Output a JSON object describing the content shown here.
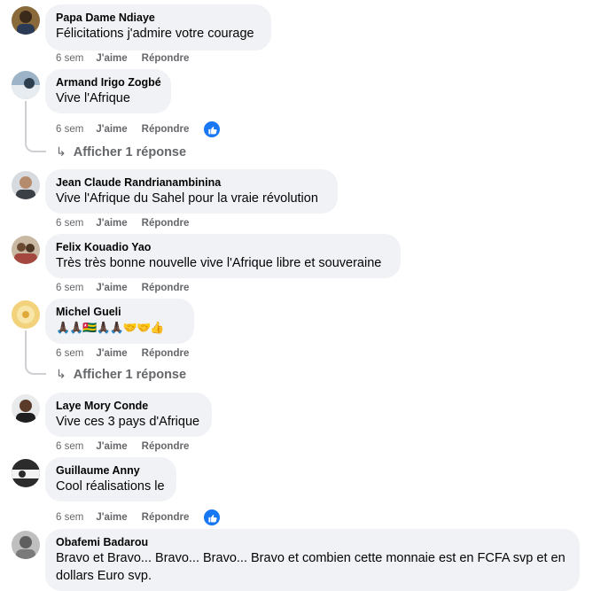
{
  "comments": [
    {
      "name": "Papa Dame Ndiaye",
      "text": "Félicitations j'admire votre courage",
      "time": "6 sem",
      "like": "J'aime",
      "reply": "Répondre"
    },
    {
      "name": "Armand Irigo Zogbé",
      "text": "Vive l'Afrique",
      "time": "6 sem",
      "like": "J'aime",
      "reply": "Répondre",
      "replies_label": "Afficher 1 réponse"
    },
    {
      "name": "Jean Claude Randrianambinina",
      "text": "Vive l'Afrique du Sahel pour la vraie révolution",
      "time": "6 sem",
      "like": "J'aime",
      "reply": "Répondre"
    },
    {
      "name": "Felix Kouadio Yao",
      "text": "Très très bonne nouvelle vive l'Afrique libre et souveraine",
      "time": "6 sem",
      "like": "J'aime",
      "reply": "Répondre"
    },
    {
      "name": "Michel Gueli",
      "text": "🙏🏿🙏🏿🇹🇬🙏🏿🙏🏿🤝🤝👍",
      "time": "6 sem",
      "like": "J'aime",
      "reply": "Répondre",
      "replies_label": "Afficher 1 réponse"
    },
    {
      "name": "Laye Mory Conde",
      "text": "Vive ces 3 pays d'Afrique",
      "time": "6 sem",
      "like": "J'aime",
      "reply": "Répondre"
    },
    {
      "name": "Guillaume Anny",
      "text": "Cool réalisations le",
      "time": "6 sem",
      "like": "J'aime",
      "reply": "Répondre"
    },
    {
      "name": "Obafemi Badarou",
      "text": "Bravo et Bravo... Bravo... Bravo... Bravo et combien cette monnaie est en FCFA svp et en dollars Euro svp."
    }
  ],
  "icons": {
    "reaction": "like-thumb-icon",
    "reply_arrow": "reply-arrow-icon"
  },
  "colors": {
    "bubble": "#f0f2f5",
    "meta": "#65676b",
    "like_blue": "#1877f2"
  }
}
